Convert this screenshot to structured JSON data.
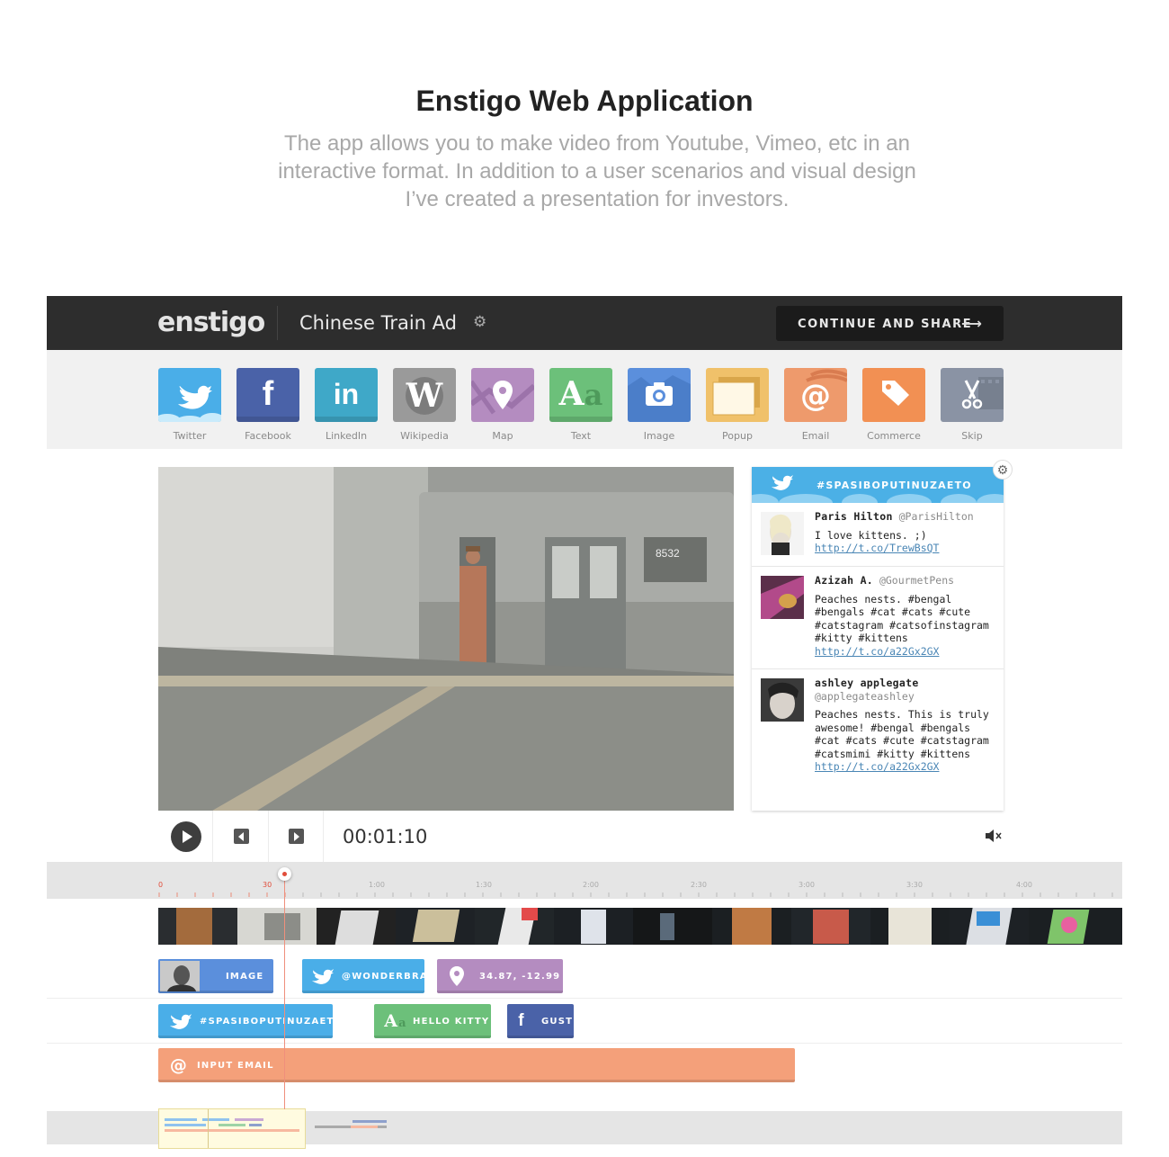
{
  "intro": {
    "title": "Enstigo Web Application",
    "description": "The app allows you to make video from Youtube, Vimeo, etc in an interactive format. In addition to a user scenarios and visual design I’ve created a presentation for investors."
  },
  "topbar": {
    "logo": "enstigo",
    "project_title": "Chinese Train Ad",
    "continue_label": "CONTINUE AND SHARE"
  },
  "toolbar": {
    "items": [
      {
        "label": "Twitter",
        "color": "#4aaee8",
        "icon": "twitter-bird-icon"
      },
      {
        "label": "Facebook",
        "color": "#4a62a8",
        "icon": "facebook-icon"
      },
      {
        "label": "LinkedIn",
        "color": "#3fa8c8",
        "icon": "linkedin-icon"
      },
      {
        "label": "Wikipedia",
        "color": "#9a9a9a",
        "icon": "wikipedia-icon"
      },
      {
        "label": "Map",
        "color": "#b48cc0",
        "icon": "map-pin-icon"
      },
      {
        "label": "Text",
        "color": "#6cc07a",
        "icon": "text-icon"
      },
      {
        "label": "Image",
        "color": "#5b8fdc",
        "icon": "camera-icon"
      },
      {
        "label": "Popup",
        "color": "#f0c16a",
        "icon": "popup-icon"
      },
      {
        "label": "Email",
        "color": "#ee9a6c",
        "icon": "at-icon"
      },
      {
        "label": "Commerce",
        "color": "#f29053",
        "icon": "tag-icon"
      },
      {
        "label": "Skip",
        "color": "#8a93a4",
        "icon": "scissors-icon"
      }
    ]
  },
  "player": {
    "timecode": "00:01:10"
  },
  "twitter_widget": {
    "hashtag": "#SPASIBOPUTINUZAETO",
    "tweets": [
      {
        "name": "Paris Hilton",
        "handle": "@ParisHilton",
        "text": "I love kittens. ;)",
        "link": "http://t.co/TrewBsQT"
      },
      {
        "name": "Azizah A.",
        "handle": "@GourmetPens",
        "text": "Peaches nests. #bengal #bengals #cat #cats #cute #catstagram #catsofinstagram #kitty #kittens",
        "link": "http://t.co/a22Gx2GX"
      },
      {
        "name": "ashley applegate",
        "handle": "@applegateashley",
        "text": "Peaches nests. This is truly awesome! #bengal #bengals #cat #cats #cute #catstagram #catsmimi #kitty #kittens",
        "link": "http://t.co/a22Gx2GX"
      }
    ]
  },
  "timeline": {
    "ruler_labels": [
      "0",
      "30",
      "1:00",
      "1:30",
      "2:00",
      "2:30",
      "3:00",
      "3:30",
      "4:00"
    ],
    "clips": {
      "image": "IMAGE",
      "wonderbra": "@WONDERBRA",
      "coords": "34.87, -12.99",
      "hashtag": "#SPASIBOPUTINUZAETO",
      "hello_kitty": "HELLO KITTY",
      "gust": "GUST",
      "input_email": "INPUT EMAIL"
    }
  },
  "colors": {
    "twitter": "#4aaee8",
    "image": "#5b8fdc",
    "map": "#b48cc0",
    "text": "#6cc07a",
    "facebook": "#4a62a8",
    "email": "#f4a07a",
    "playhead": "#e14d3a"
  }
}
